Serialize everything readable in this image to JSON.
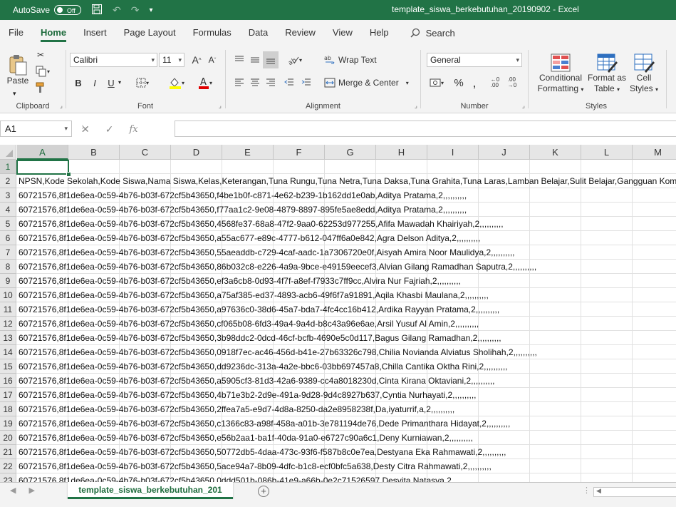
{
  "titlebar": {
    "autosave_label": "AutoSave",
    "autosave_state": "Off",
    "doc_title": "template_siswa_berkebutuhan_20190902  -  Excel"
  },
  "tabs": [
    "File",
    "Home",
    "Insert",
    "Page Layout",
    "Formulas",
    "Data",
    "Review",
    "View",
    "Help"
  ],
  "active_tab": "Home",
  "search_label": "Search",
  "ribbon": {
    "clipboard": {
      "label": "Clipboard",
      "paste": "Paste"
    },
    "font": {
      "label": "Font",
      "name": "Calibri",
      "size": "11",
      "bold": "B",
      "italic": "I",
      "underline": "U"
    },
    "alignment": {
      "label": "Alignment",
      "wrap": "Wrap Text",
      "merge": "Merge & Center"
    },
    "number": {
      "label": "Number",
      "format": "General"
    },
    "styles": {
      "label": "Styles",
      "conditional": [
        "Conditional",
        "Formatting"
      ],
      "format_table": [
        "Format as",
        "Table"
      ],
      "cell_styles": [
        "Cell",
        "Styles"
      ]
    }
  },
  "namebox": "A1",
  "fx_label": "fx",
  "columns": [
    "A",
    "B",
    "C",
    "D",
    "E",
    "F",
    "G",
    "H",
    "I",
    "J",
    "K",
    "L",
    "M"
  ],
  "rows": [
    {
      "n": "1",
      "text": ""
    },
    {
      "n": "2",
      "text": "NPSN,Kode Sekolah,Kode Siswa,Nama Siswa,Kelas,Keterangan,Tuna Rungu,Tuna Netra,Tuna Daksa,Tuna Grahita,Tuna Laras,Lamban Belajar,Sulit Belajar,Gangguan Komunikasi,Bakat Luar Biasa"
    },
    {
      "n": "3",
      "text": "60721576,8f1de6ea-0c59-4b76-b03f-672cf5b43650,f4be1b0f-c871-4e62-b239-1b162dd1e0ab,Aditya Pratama,2,,,,,,,,,,"
    },
    {
      "n": "4",
      "text": "60721576,8f1de6ea-0c59-4b76-b03f-672cf5b43650,f77aa1c2-9e08-4879-8897-895fe5ae8edd,Aditya Pratama,2,,,,,,,,,,"
    },
    {
      "n": "5",
      "text": "60721576,8f1de6ea-0c59-4b76-b03f-672cf5b43650,4568fe37-68a8-47f2-9aa0-62253d977255,Afifa Mawadah Khairiyah,2,,,,,,,,,,"
    },
    {
      "n": "6",
      "text": "60721576,8f1de6ea-0c59-4b76-b03f-672cf5b43650,a55ac677-e89c-4777-b612-047ff6a0e842,Agra Delson Aditya,2,,,,,,,,,,"
    },
    {
      "n": "7",
      "text": "60721576,8f1de6ea-0c59-4b76-b03f-672cf5b43650,55aeaddb-c729-4caf-aadc-1a7306720e0f,Aisyah Amira Noor Maulidya,2,,,,,,,,,,"
    },
    {
      "n": "8",
      "text": "60721576,8f1de6ea-0c59-4b76-b03f-672cf5b43650,86b032c8-e226-4a9a-9bce-e49159eecef3,Alvian Gilang Ramadhan Saputra,2,,,,,,,,,,"
    },
    {
      "n": "9",
      "text": "60721576,8f1de6ea-0c59-4b76-b03f-672cf5b43650,ef3a6cb8-0d93-4f7f-a8ef-f7933c7ff9cc,Alvira Nur Fajriah,2,,,,,,,,,,"
    },
    {
      "n": "10",
      "text": "60721576,8f1de6ea-0c59-4b76-b03f-672cf5b43650,a75af385-ed37-4893-acb6-49f6f7a91891,Aqila Khasbi Maulana,2,,,,,,,,,,"
    },
    {
      "n": "11",
      "text": "60721576,8f1de6ea-0c59-4b76-b03f-672cf5b43650,a97636c0-38d6-45a7-bda7-4fc4cc16b412,Ardika Rayyan Pratama,2,,,,,,,,,,"
    },
    {
      "n": "12",
      "text": "60721576,8f1de6ea-0c59-4b76-b03f-672cf5b43650,cf065b08-6fd3-49a4-9a4d-b8c43a96e6ae,Arsil Yusuf Al Amin,2,,,,,,,,,,"
    },
    {
      "n": "13",
      "text": "60721576,8f1de6ea-0c59-4b76-b03f-672cf5b43650,3b98ddc2-0dcd-46cf-bcfb-4690e5c0d117,Bagus Gilang Ramadhan,2,,,,,,,,,,"
    },
    {
      "n": "14",
      "text": "60721576,8f1de6ea-0c59-4b76-b03f-672cf5b43650,0918f7ec-ac46-456d-b41e-27b63326c798,Chilia Novianda Alviatus Sholihah,2,,,,,,,,,,"
    },
    {
      "n": "15",
      "text": "60721576,8f1de6ea-0c59-4b76-b03f-672cf5b43650,dd9236dc-313a-4a2e-bbc6-03bb697457a8,Chilla Cantika Oktha Rini,2,,,,,,,,,,"
    },
    {
      "n": "16",
      "text": "60721576,8f1de6ea-0c59-4b76-b03f-672cf5b43650,a5905cf3-81d3-42a6-9389-cc4a8018230d,Cinta Kirana Oktaviani,2,,,,,,,,,,"
    },
    {
      "n": "17",
      "text": "60721576,8f1de6ea-0c59-4b76-b03f-672cf5b43650,4b71e3b2-2d9e-491a-9d28-9d4c8927b637,Cyntia Nurhayati,2,,,,,,,,,,"
    },
    {
      "n": "18",
      "text": "60721576,8f1de6ea-0c59-4b76-b03f-672cf5b43650,2ffea7a5-e9d7-4d8a-8250-da2e8958238f,Da,iyaturrif,a,2,,,,,,,,,,"
    },
    {
      "n": "19",
      "text": "60721576,8f1de6ea-0c59-4b76-b03f-672cf5b43650,c1366c83-a98f-458a-a01b-3e781194de76,Dede Primanthara Hidayat,2,,,,,,,,,,"
    },
    {
      "n": "20",
      "text": "60721576,8f1de6ea-0c59-4b76-b03f-672cf5b43650,e56b2aa1-ba1f-40da-91a0-e6727c90a6c1,Deny Kurniawan,2,,,,,,,,,,"
    },
    {
      "n": "21",
      "text": "60721576,8f1de6ea-0c59-4b76-b03f-672cf5b43650,50772db5-4daa-473c-93f6-f587b8c0e7ea,Destyana Eka Rahmawati,2,,,,,,,,,,"
    },
    {
      "n": "22",
      "text": "60721576,8f1de6ea-0c59-4b76-b03f-672cf5b43650,5ace94a7-8b09-4dfc-b1c8-ecf0bfc5a638,Desty Citra Rahmawati,2,,,,,,,,,,"
    },
    {
      "n": "23",
      "text": "60721576,8f1de6ea-0c59-4b76-b03f-672cf5b43650,0ddd501b-086b-41e9-a66b-0e2c71526597,Desvita Natasya,2,,,,,,,,,,"
    }
  ],
  "sheet_tab": "template_siswa_berkebutuhan_201",
  "colors": {
    "accent": "#217346",
    "ribbon_bg": "#f3f3f3",
    "header_bg": "#e6e6e6"
  }
}
